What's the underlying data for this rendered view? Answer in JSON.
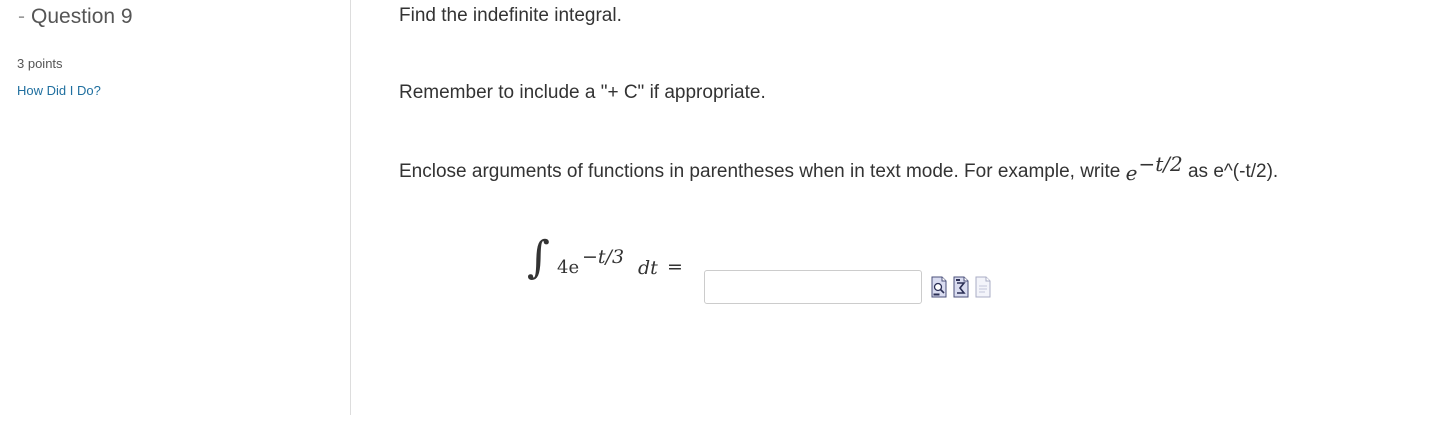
{
  "sidebar": {
    "question_dash": "-",
    "question_title": "Question 9",
    "points": "3 points",
    "help_link": "How Did I Do?"
  },
  "question": {
    "line1": "Find the indefinite integral.",
    "line2": "Remember to include a \"+ C\" if appropriate.",
    "line3_prefix": "Enclose arguments of functions in parentheses when in text mode. For example, write ",
    "line3_math_base": "e",
    "line3_math_exp": "−t/2",
    "line3_suffix": " as e^(-t/2).",
    "integral_sign": "∫",
    "integrand_coef": "4e",
    "integrand_exp": "−t/3",
    "differential": "dt",
    "equals": "="
  },
  "answer": {
    "value": "",
    "placeholder": ""
  },
  "tools": [
    {
      "icon": "preview-icon"
    },
    {
      "icon": "equation-editor-icon"
    },
    {
      "icon": "text-mode-icon"
    }
  ],
  "colors": {
    "link": "#1f6f9f",
    "text": "#333333",
    "divider": "#dddddd"
  }
}
